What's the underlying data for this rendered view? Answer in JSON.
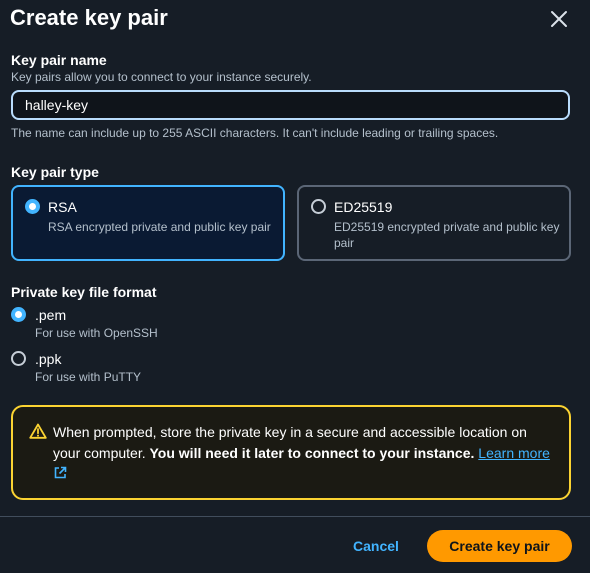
{
  "dialog": {
    "title": "Create key pair",
    "close_icon": "close-icon"
  },
  "key_name": {
    "label": "Key pair name",
    "description": "Key pairs allow you to connect to your instance securely.",
    "value": "halley-key",
    "constraint": "The name can include up to 255 ASCII characters. It can't include leading or trailing spaces."
  },
  "key_type": {
    "label": "Key pair type",
    "selected": "RSA",
    "options": [
      {
        "title": "RSA",
        "description": "RSA encrypted private and public key pair"
      },
      {
        "title": "ED25519",
        "description": "ED25519 encrypted private and public key pair"
      }
    ]
  },
  "file_format": {
    "label": "Private key file format",
    "selected": ".pem",
    "options": [
      {
        "title": ".pem",
        "description": "For use with OpenSSH"
      },
      {
        "title": ".ppk",
        "description": "For use with PuTTY"
      }
    ]
  },
  "alert": {
    "icon": "warning-icon",
    "text": "When prompted, store the private key in a secure and accessible location on your computer.",
    "bold_text": "You will need it later to connect to your instance.",
    "link_text": "Learn more",
    "link_icon": "external-link-icon"
  },
  "footer": {
    "cancel_label": "Cancel",
    "create_label": "Create key pair"
  },
  "colors": {
    "accent": "#42b4ff",
    "primary_button": "#ff9900",
    "warning": "#fbd332",
    "background": "#161d26"
  }
}
